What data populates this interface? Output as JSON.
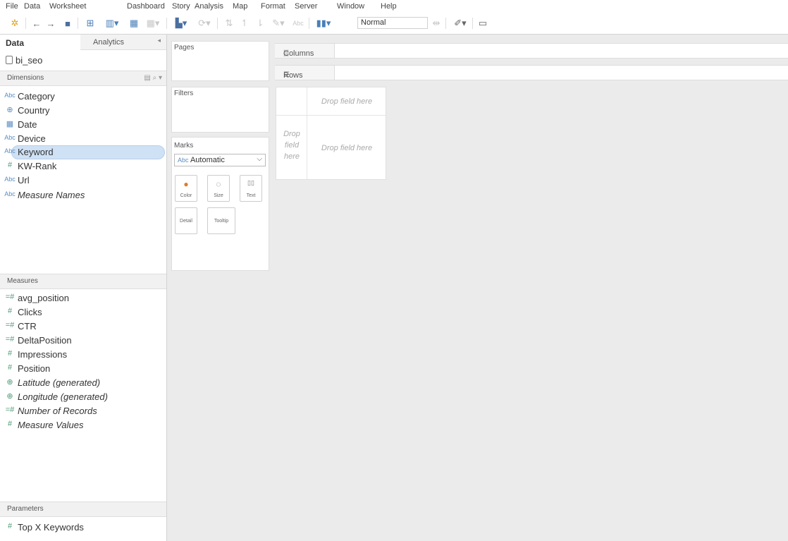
{
  "menu": [
    "File",
    "Data",
    "Worksheet",
    "Dashboard",
    "Story",
    "Analysis",
    "Map",
    "Format",
    "Server",
    "Window",
    "Help"
  ],
  "toolbar": {
    "mark_type": "Normal"
  },
  "tabs": {
    "data": "Data",
    "analytics": "Analytics"
  },
  "datasource": "bi_seo",
  "dimensions": {
    "header": "Dimensions",
    "items": [
      {
        "label": "Category",
        "icon": "Abc"
      },
      {
        "label": "Country",
        "icon": "globe"
      },
      {
        "label": "Date",
        "icon": "calendar"
      },
      {
        "label": "Device",
        "icon": "Abc"
      },
      {
        "label": "Keyword",
        "icon": "Abc"
      },
      {
        "label": "KW-Rank",
        "icon": "#"
      },
      {
        "label": "Url",
        "icon": "Abc"
      },
      {
        "label": "Measure Names",
        "icon": "Abc"
      }
    ]
  },
  "measures": {
    "header": "Measures",
    "items": [
      {
        "label": "avg_position"
      },
      {
        "label": "Clicks"
      },
      {
        "label": "CTR"
      },
      {
        "label": "DeltaPosition"
      },
      {
        "label": "Impressions"
      },
      {
        "label": "Position"
      },
      {
        "label": "Latitude (generated)"
      },
      {
        "label": "Longitude (generated)"
      },
      {
        "label": "Number of Records"
      },
      {
        "label": "Measure Values"
      }
    ]
  },
  "parameters": {
    "header": "Parameters",
    "items": [
      {
        "label": "Top X Keywords"
      }
    ]
  },
  "cards": {
    "pages": "Pages",
    "filters": "Filters",
    "marks": "Marks"
  },
  "marks": {
    "type": "Automatic",
    "type_prefix": "Abc",
    "buttons": {
      "color": "Color",
      "size": "Size",
      "text": "Text",
      "detail": "Detail",
      "tooltip": "Tooltip"
    }
  },
  "shelves": {
    "columns": "Columns",
    "rows": "Rows"
  },
  "view": {
    "drop_top": "Drop field here",
    "drop_left": "Drop field here",
    "drop_main": "Drop field here"
  }
}
